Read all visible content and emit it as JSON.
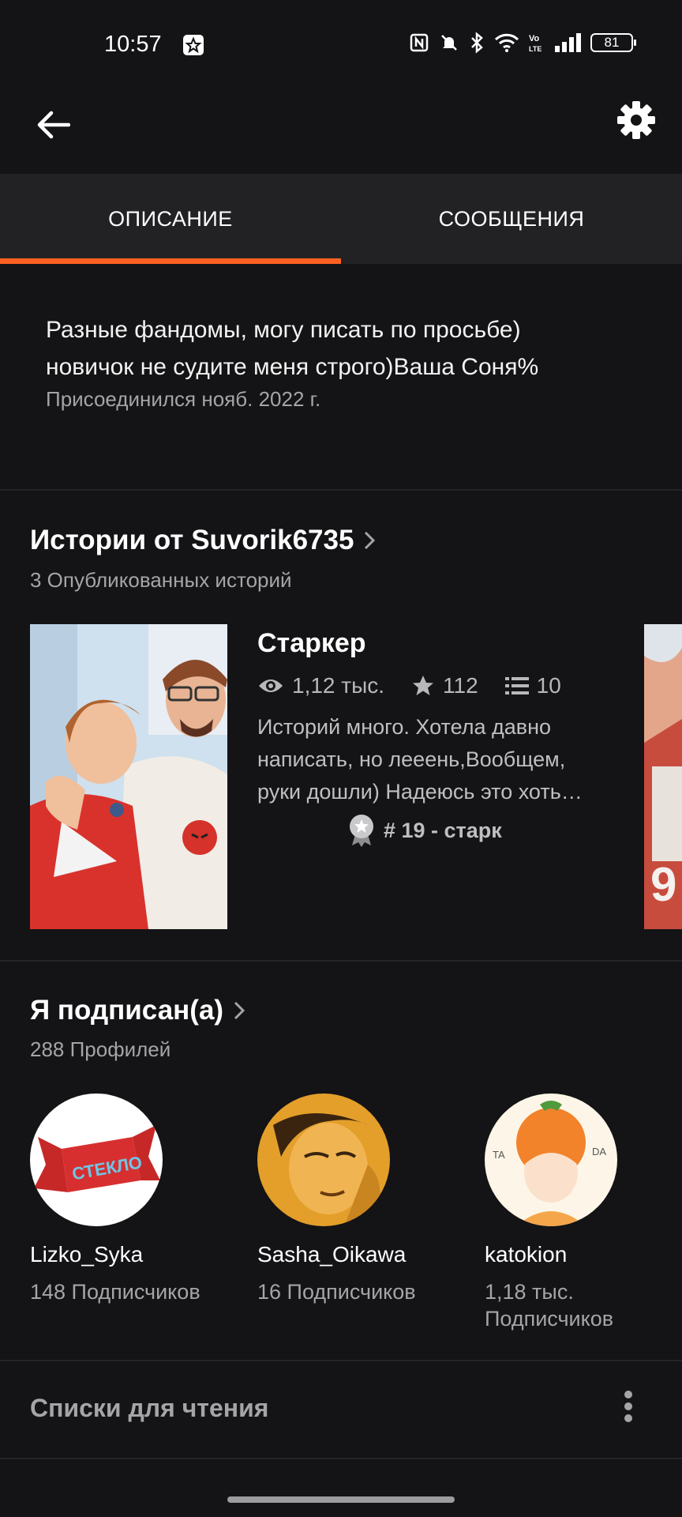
{
  "status_bar": {
    "time": "10:57",
    "battery": "81",
    "icons": [
      "notification-app-icon",
      "nfc-icon",
      "mute-icon",
      "bluetooth-icon",
      "wifi-icon",
      "volte-icon",
      "signal-icon",
      "battery-icon"
    ]
  },
  "app_bar": {
    "back_icon": "arrow-left-icon",
    "settings_icon": "gear-icon"
  },
  "tabs": [
    {
      "label": "ОПИСАНИЕ",
      "active": true
    },
    {
      "label": "СООБЩЕНИЯ",
      "active": false
    }
  ],
  "colors": {
    "accent": "#ff6122",
    "background": "#141315",
    "tab_bar": "#222124"
  },
  "about": {
    "description_line1": "Разные фандомы, могу писать по просьбе)",
    "description_line2": "новичок не судите меня строго)Ваша Соня%",
    "joined": "Присоединился нояб. 2022 г."
  },
  "stories": {
    "title": "Истории от Suvorik6735",
    "subtitle": "3 Опубликованных историй",
    "items": [
      {
        "title": "Старкер",
        "views": "1,12 тыс.",
        "votes": "112",
        "parts": "10",
        "description_line1": "Историй много. Хотела давно",
        "description_line2": "написать, но лееень,Вообщем,",
        "description_line3": "руки дошли) Надеюсь это хоть…",
        "rank_tag": "# 19 - старк"
      }
    ]
  },
  "following": {
    "title": "Я подписан(а)",
    "subtitle": "288 Профилей",
    "profiles": [
      {
        "name": "Lizko_Syka",
        "followers": "148 Подписчиков",
        "avatar_text": "СТЕКЛО"
      },
      {
        "name": "Sasha_Oikawa",
        "followers": "16 Подписчиков"
      },
      {
        "name": "katokion",
        "followers_line1": "1,18 тыс.",
        "followers_line2": "Подписчиков",
        "avatar_text_left": "TA",
        "avatar_text_right": "DA"
      }
    ]
  },
  "reading_lists": {
    "label": "Списки для чтения"
  }
}
